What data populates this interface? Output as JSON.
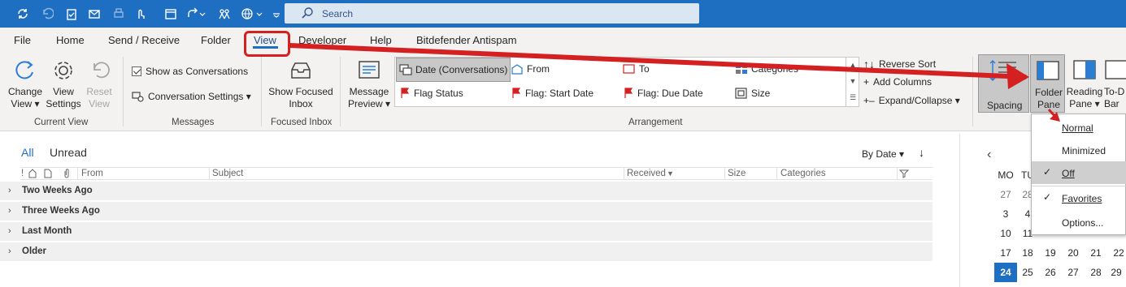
{
  "search": {
    "placeholder": "Search"
  },
  "tabs": [
    "File",
    "Home",
    "Send / Receive",
    "Folder",
    "View",
    "Developer",
    "Help",
    "Bitdefender Antispam"
  ],
  "ribbon": {
    "current_view": {
      "change_view": [
        "Change",
        "View ▾"
      ],
      "view_settings": [
        "View",
        "Settings"
      ],
      "reset_view": [
        "Reset",
        "View"
      ],
      "label": "Current View"
    },
    "messages": {
      "show_as_conversations": "Show as Conversations",
      "conversation_settings": "Conversation Settings ▾",
      "label": "Messages"
    },
    "focused_inbox": {
      "button": [
        "Show Focused",
        "Inbox"
      ],
      "label": "Focused Inbox"
    },
    "arrangement": {
      "message_preview": [
        "Message",
        "Preview ▾"
      ],
      "items": [
        "Date (Conversations)",
        "From",
        "To",
        "Categories",
        "Flag Status",
        "Flag: Start Date",
        "Flag: Due Date",
        "Size"
      ],
      "reverse_sort": "Reverse Sort",
      "add_columns": "Add Columns",
      "expand_collapse": "Expand/Collapse ▾",
      "label": "Arrangement"
    },
    "layout": {
      "spacing": "Spacing",
      "folder_pane": [
        "Folder",
        "Pane ▾"
      ],
      "reading_pane": [
        "Reading",
        "Pane ▾"
      ],
      "todo_bar": [
        "To-D",
        "Bar"
      ]
    }
  },
  "list": {
    "filter_all": "All",
    "filter_unread": "Unread",
    "sort": "By Date ▾",
    "sort_dir": "↓",
    "columns": [
      "!",
      "From",
      "Subject",
      "Received",
      "Size",
      "Categories"
    ],
    "groups": [
      "Two Weeks Ago",
      "Three Weeks Ago",
      "Last Month",
      "Older"
    ]
  },
  "calendar": {
    "nav_prev": "‹",
    "weekdays": [
      "MO",
      "TU"
    ],
    "rows": [
      [
        "27",
        "28",
        "",
        "",
        "",
        ""
      ],
      [
        "3",
        "4",
        "",
        "",
        "",
        ""
      ],
      [
        "10",
        "11",
        "",
        "",
        "",
        ""
      ],
      [
        "17",
        "18",
        "19",
        "20",
        "21",
        "22"
      ],
      [
        "24",
        "25",
        "26",
        "27",
        "28",
        "29"
      ]
    ]
  },
  "folder_pane_menu": {
    "items": [
      {
        "label": "Normal",
        "checked": false
      },
      {
        "label": "Minimized",
        "checked": false
      },
      {
        "label": "Off",
        "checked": true
      },
      {
        "label": "Favorites",
        "checked": true
      },
      {
        "label": "Options...",
        "checked": false
      }
    ]
  },
  "colors": {
    "titlebar": "#1e6fc2",
    "annotation": "#d42020",
    "ribbon": "#f3f2f1"
  }
}
